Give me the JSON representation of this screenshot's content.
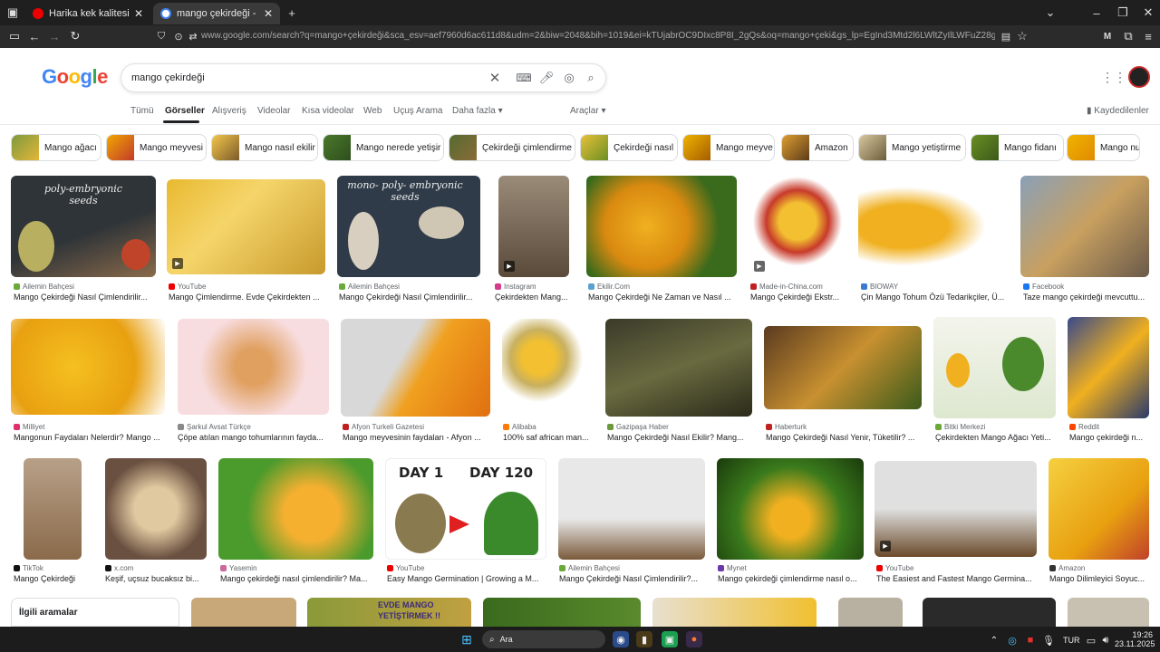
{
  "browser": {
    "tabs": [
      {
        "title": "Harika kek kalitesi! Mangolu kek",
        "active": false
      },
      {
        "title": "mango çekirdeği - Google'da Ar",
        "active": true
      }
    ],
    "new_tab": "+",
    "url": "www.google.com/search?q=mango+çekirdeği&sca_esv=aef7960d6ac611d8&udm=2&biw=2048&bih=1019&ei=kTUjabrOC9DIxc8P8I_2gQs&oq=mango+çeki&gs_lp=EgInd3Mtd2l6LWltZyIlLWFuZ28gw6dla2kqAgg8MgUQABiABD"
  },
  "google": {
    "logo": "Google",
    "query": "mango çekirdeği",
    "nav": [
      "Tümü",
      "Görseller",
      "Alışveriş",
      "Videolar",
      "Kısa videolar",
      "Web",
      "Uçuş Arama",
      "Daha fazla"
    ],
    "tools": "Araçlar",
    "saved": "Kaydedilenler",
    "chips": [
      "Mango ağacı",
      "Mango meyvesi",
      "Mango nasıl ekilir",
      "Mango nerede yetişir",
      "Çekirdeği çimlendirme",
      "Çekirdeği nasıl",
      "Mango meyve",
      "Amazon",
      "Mango yetiştirme",
      "Mango fidanı",
      "Mango num"
    ]
  },
  "results": [
    {
      "source": "Ailemin Bahçesi",
      "caption": "Mango Çekirdeği Nasıl Çimlendirilir..."
    },
    {
      "source": "YouTube",
      "caption": "Mango Çimlendirme. Evde Çekirdekten ..."
    },
    {
      "source": "Ailemin Bahçesi",
      "caption": "Mango Çekirdeği Nasıl Çimlendirilir..."
    },
    {
      "source": "Instagram",
      "caption": "Çekirdekten Mang..."
    },
    {
      "source": "Ekilir.Com",
      "caption": "Mango Çekirdeği Ne Zaman ve Nasıl ..."
    },
    {
      "source": "Made-in-China.com",
      "caption": "Mango Çekirdeği Ekstr..."
    },
    {
      "source": "BIOWAY",
      "caption": "Çin Mango Tohum Özü Tedarikçiler, Ü..."
    },
    {
      "source": "Facebook",
      "caption": "Taze mango çekirdeği mevcuttu..."
    },
    {
      "source": "Milliyet",
      "caption": "Mangonun Faydaları Nelerdir? Mango ..."
    },
    {
      "source": "Şarkul Avsat Türkçe",
      "caption": "Çöpe atılan mango tohumlarının fayda..."
    },
    {
      "source": "Afyon Turkeli Gazetesi",
      "caption": "Mango meyvesinin faydaları - Afyon ..."
    },
    {
      "source": "Alibaba",
      "caption": "100% saf african man..."
    },
    {
      "source": "Gazipaşa Haber",
      "caption": "Mango Çekirdeği Nasıl Ekilir? Mang..."
    },
    {
      "source": "Haberturk",
      "caption": "Mango Çekirdeği Nasıl Yenir, Tüketilir? ..."
    },
    {
      "source": "Bitki Merkezi",
      "caption": "Çekirdekten Mango Ağacı Yeti..."
    },
    {
      "source": "Reddit",
      "caption": "Mango çekirdeği n..."
    },
    {
      "source": "TikTok",
      "caption": "Mango Çekirdeği ..."
    },
    {
      "source": "x.com",
      "caption": "Keşif, uçsuz bucaksız bi..."
    },
    {
      "source": "Yasemin",
      "caption": "Mango çekirdeği nasıl çimlendirilir? Ma..."
    },
    {
      "source": "YouTube",
      "caption": "Easy Mango Germination | Growing a M..."
    },
    {
      "source": "Ailemin Bahçesi",
      "caption": "Mango Çekirdeği Nasıl Çimlendirilir?..."
    },
    {
      "source": "Mynet",
      "caption": "Mango çekirdeği çimlendirme nasıl o..."
    },
    {
      "source": "YouTube",
      "caption": "The Easiest and Fastest Mango Germina..."
    },
    {
      "source": "Amazon",
      "caption": "Mango Dilimleyici Soyuc..."
    }
  ],
  "image_texts": {
    "poly": "poly-embryonic seeds",
    "mono": "mono- poly- embryonic seeds",
    "day1": "DAY 1",
    "day120": "DAY 120",
    "evde": "EVDE MANGO YETİŞTİRMEK !!"
  },
  "related": "İlgili aramalar",
  "taskbar": {
    "search": "Ara",
    "lang": "TUR",
    "time": "19:26",
    "date": "23.11.2025"
  }
}
